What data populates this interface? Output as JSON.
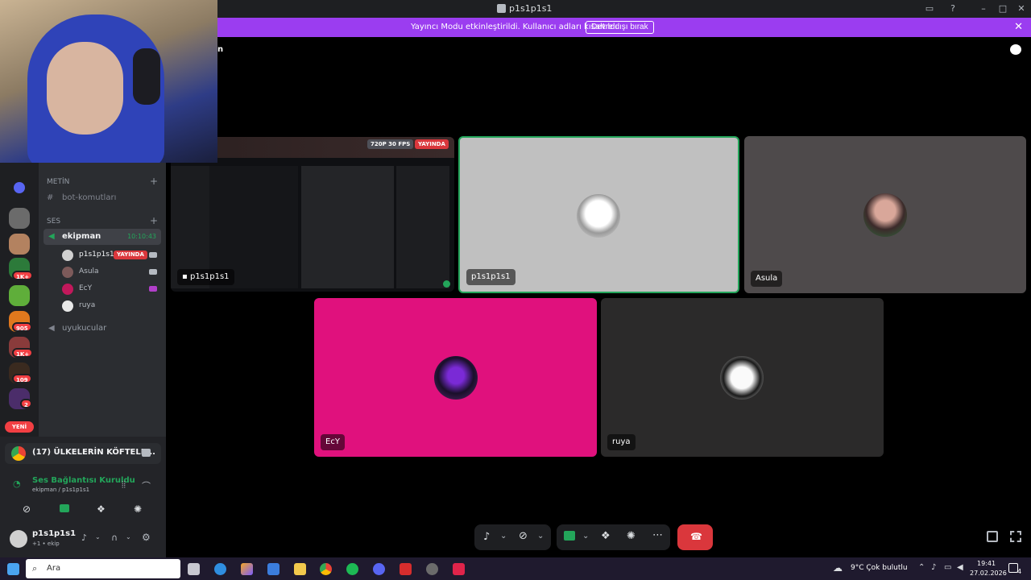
{
  "window": {
    "title": "p1s1p1s1"
  },
  "banner": {
    "text": "Yayıncı Modu etkinleştirildi. Kullanıcı adları kısaltıldı.",
    "button": "Devre dışı bırak",
    "color": "#9b3df0"
  },
  "header_fragment": "n",
  "sidebar": {
    "text_category": "METİN",
    "text_channels": [
      "bot-komutları"
    ],
    "voice_category": "SES",
    "voice_channel": {
      "name": "ekipman",
      "timer": "10:10:43"
    },
    "members": [
      {
        "name": "p1s1p1s1",
        "badge": "YAYINDA"
      },
      {
        "name": "Asula"
      },
      {
        "name": "EcY"
      },
      {
        "name": "ruya"
      }
    ],
    "other_channel": "uyukucular"
  },
  "rail": {
    "badges": [
      "1K+",
      "905",
      "1K+",
      "109",
      "2"
    ],
    "new_label": "YENİ"
  },
  "activity": {
    "text": "(17) ÜLKELERİN KÖFTELE..."
  },
  "connection": {
    "status": "Ses Bağlantısı Kuruldu",
    "detail": "ekipman / p1s1p1s1"
  },
  "user": {
    "name": "p1s1p1s1",
    "status": "+1 • ekip"
  },
  "stage": {
    "stream": {
      "label": "p1s1p1s1",
      "quality": "720P 30 FPS",
      "live": "YAYINDA"
    },
    "tiles": [
      {
        "label": "p1s1p1s1",
        "color": "#c0c0c0"
      },
      {
        "label": "Asula",
        "color": "#4e4a4b"
      },
      {
        "label": "EcY",
        "color": "#e0117d"
      },
      {
        "label": "ruya",
        "color": "#2b2a2a"
      }
    ]
  },
  "taskbar": {
    "search_placeholder": "Ara",
    "weather": "9°C  Çok bulutlu",
    "time": "19:41",
    "date": "27.02.2026",
    "notif_count": "4"
  }
}
